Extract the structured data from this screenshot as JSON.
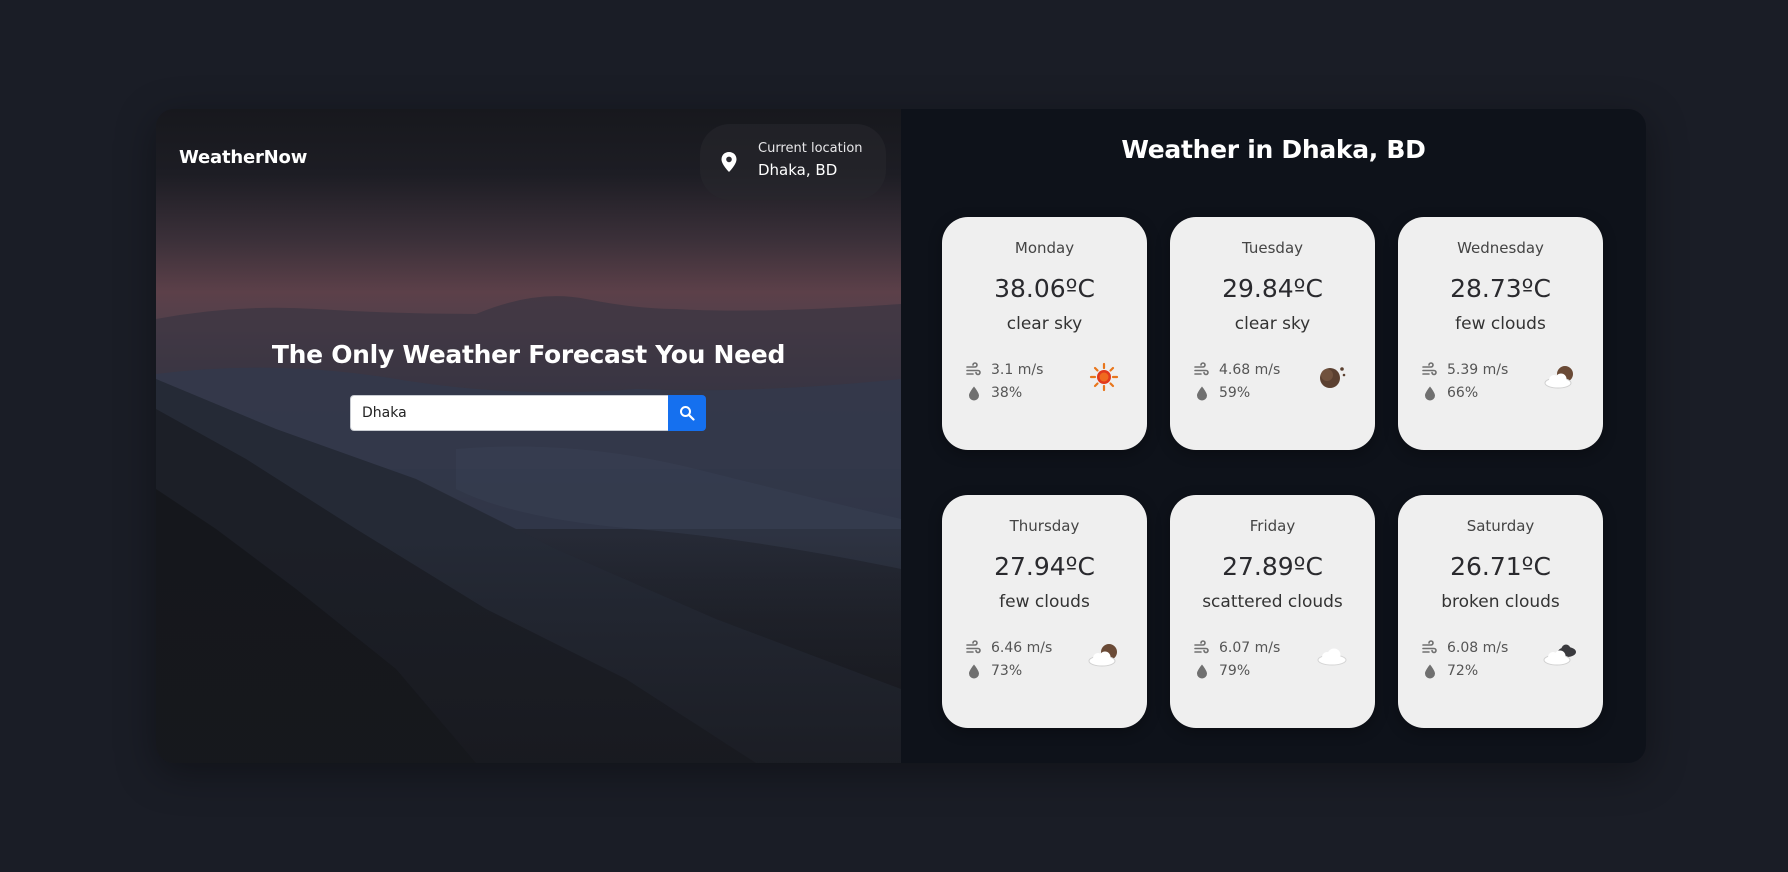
{
  "app": {
    "brand": "WeatherNow",
    "location_chip": {
      "label": "Current location",
      "value": "Dhaka, BD",
      "icon": "map-pin-icon"
    }
  },
  "hero": {
    "title": "The Only Weather Forecast You Need",
    "search": {
      "value": "Dhaka",
      "placeholder": "",
      "button_icon": "search-icon"
    }
  },
  "panel": {
    "title": "Weather in Dhaka, BD",
    "days": [
      {
        "day": "Monday",
        "temp": "38.06ºC",
        "condition": "clear sky",
        "wind": "3.1 m/s",
        "humidity": "38%",
        "icon": "sun-icon"
      },
      {
        "day": "Tuesday",
        "temp": "29.84ºC",
        "condition": "clear sky",
        "wind": "4.68 m/s",
        "humidity": "59%",
        "icon": "moon-icon"
      },
      {
        "day": "Wednesday",
        "temp": "28.73ºC",
        "condition": "few clouds",
        "wind": "5.39 m/s",
        "humidity": "66%",
        "icon": "moon-cloud-icon"
      },
      {
        "day": "Thursday",
        "temp": "27.94ºC",
        "condition": "few clouds",
        "wind": "6.46 m/s",
        "humidity": "73%",
        "icon": "moon-cloud-icon"
      },
      {
        "day": "Friday",
        "temp": "27.89ºC",
        "condition": "scattered clouds",
        "wind": "6.07 m/s",
        "humidity": "79%",
        "icon": "cloud-icon"
      },
      {
        "day": "Saturday",
        "temp": "26.71ºC",
        "condition": "broken clouds",
        "wind": "6.08 m/s",
        "humidity": "72%",
        "icon": "broken-clouds-icon"
      }
    ]
  },
  "colors": {
    "page_bg": "#1a1d26",
    "panel_bg": "#0e121a",
    "card_bg": "#efefef",
    "accent": "#1570ef"
  }
}
